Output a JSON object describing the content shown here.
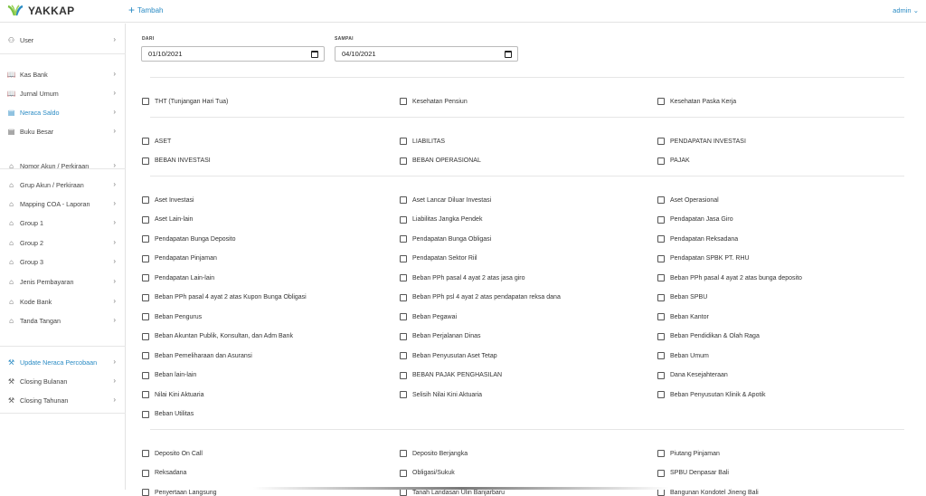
{
  "app": {
    "name": "YAKKAP",
    "add_label": "Tambah",
    "user_menu": "admin"
  },
  "colors": {
    "accent": "#2a8bc4",
    "logo_green": "#7cc242",
    "logo_blue": "#2a8bc4"
  },
  "sidebar": {
    "items": [
      {
        "label": "User",
        "icon": "users-icon"
      },
      {
        "label": "Kas Bank",
        "icon": "book-icon"
      },
      {
        "label": "Jurnal Umum",
        "icon": "book-icon"
      },
      {
        "label": "Neraca Saldo",
        "icon": "list-icon",
        "active": true
      },
      {
        "label": "Buku Besar",
        "icon": "list-icon"
      },
      {
        "label": "Nomor Akun / Perkiraan",
        "icon": "tag-icon"
      },
      {
        "label": "Grup Akun / Perkiraan",
        "icon": "tag-icon"
      },
      {
        "label": "Mapping COA - Laporan",
        "icon": "tag-icon"
      },
      {
        "label": "Group 1",
        "icon": "tag-icon"
      },
      {
        "label": "Group 2",
        "icon": "tag-icon"
      },
      {
        "label": "Group 3",
        "icon": "tag-icon"
      },
      {
        "label": "Jenis Pembayaran",
        "icon": "tag-icon"
      },
      {
        "label": "Kode Bank",
        "icon": "tag-icon"
      },
      {
        "label": "Tanda Tangan",
        "icon": "tag-icon"
      },
      {
        "label": "Update Neraca Percobaan",
        "icon": "tools-icon",
        "active": true
      },
      {
        "label": "Closing Bulanan",
        "icon": "tools-icon"
      },
      {
        "label": "Closing Tahunan",
        "icon": "tools-icon"
      }
    ]
  },
  "filters": {
    "dari_label": "DARI",
    "dari_value": "01/10/2021",
    "sampai_label": "SAMPAI",
    "sampai_value": "04/10/2021"
  },
  "groups": [
    [
      "THT (Tunjangan Hari Tua)",
      "Kesehatan Pensiun",
      "Kesehatan Paska Kerja"
    ],
    [
      "ASET",
      "LIABILITAS",
      "PENDAPATAN INVESTASI",
      "BEBAN INVESTASI",
      "BEBAN OPERASIONAL",
      "PAJAK"
    ],
    [
      "Aset Investasi",
      "Aset Lancar Diluar Investasi",
      "Aset Operasional",
      "Aset Lain-lain",
      "Liabilitas Jangka Pendek",
      "Pendapatan Jasa Giro",
      "Pendapatan Bunga Deposito",
      "Pendapatan Bunga Obligasi",
      "Pendapatan Reksadana",
      "Pendapatan Pinjaman",
      "Pendapatan Sektor Riil",
      "Pendapatan SPBK PT. RHU",
      "Pendapatan Lain-lain",
      "Beban PPh pasal 4 ayat 2 atas jasa giro",
      "Beban PPh pasal 4 ayat 2 atas bunga deposito",
      "Beban PPh pasal 4 ayat 2 atas Kupon Bunga Obligasi",
      "Beban PPh psl 4 ayat 2 atas pendapatan reksa dana",
      "Beban SPBU",
      "Beban Pengurus",
      "Beban Pegawai",
      "Beban Kantor",
      "Beban Akuntan Publik, Konsultan, dan Adm Bank",
      "Beban Perjalanan Dinas",
      "Beban Pendidikan & Olah Raga",
      "Beban Pemeliharaan dan Asuransi",
      "Beban Penyusutan Aset Tetap",
      "Beban Umum",
      "Beban lain-lain",
      "BEBAN PAJAK PENGHASILAN",
      "Dana Kesejahteraan",
      "Nilai Kini Aktuaria",
      "Selisih Nilai Kini Aktuaria",
      "Beban Penyusutan Klinik & Apotik",
      "Beban Utilitas"
    ],
    [
      "Deposito On Call",
      "Deposito Berjangka",
      "Piutang Pinjaman",
      "Reksadana",
      "Obligasi/Sukuk",
      "SPBU Denpasar Bali",
      "Penyertaan Langsung",
      "Tanah Landasan Ulin Banjarbaru",
      "Bangunan Kondotel Jineng Bali"
    ]
  ]
}
